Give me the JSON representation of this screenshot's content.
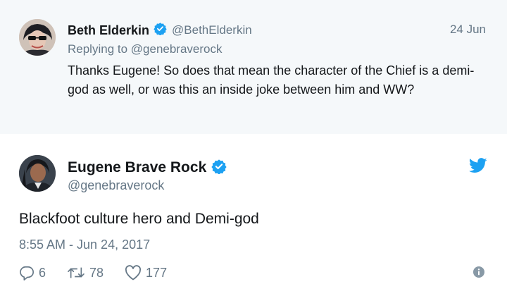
{
  "reply": {
    "name": "Beth Elderkin",
    "handle": "@BethElderkin",
    "date": "24 Jun",
    "replying_to": "Replying to @genebraverock",
    "text": "Thanks Eugene! So does that mean the character of the Chief is a demi-god as well, or was this an inside joke between him and WW?"
  },
  "tweet": {
    "name": "Eugene Brave Rock",
    "handle": "@genebraverock",
    "text": "Blackfoot culture hero and Demi-god",
    "timestamp": "8:55 AM - Jun 24, 2017",
    "replies": "6",
    "retweets": "78",
    "likes": "177"
  },
  "icons": {
    "verified": "verified-badge-icon",
    "brand": "twitter-bird-icon",
    "reply": "reply-icon",
    "retweet": "retweet-icon",
    "like": "heart-icon",
    "info": "info-icon"
  },
  "colors": {
    "brand_blue": "#1da1f2",
    "muted_text": "#657786",
    "primary_text": "#14171a",
    "reply_background": "#f5f8fa"
  }
}
